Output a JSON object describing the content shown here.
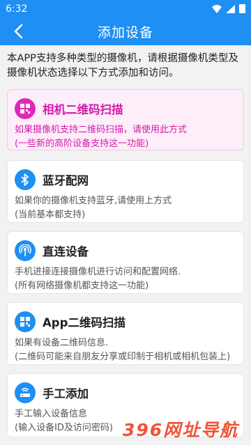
{
  "status_bar": {
    "time": "6:32"
  },
  "header": {
    "title": "添加设备"
  },
  "intro": {
    "text": "本APP支持多种类型的摄像机，请根据摄像机类型及摄像机状态选择以下方式添加和访问。"
  },
  "methods": [
    {
      "title": "相机二维码扫描",
      "line1": "如果摄像机支持二维码扫描，请使用此方式",
      "line2": "(一些新的高阶设备支持这一功能)",
      "icon": "qr-code-icon"
    },
    {
      "title": "蓝牙配网",
      "line1": "如果你的摄像机支持蓝牙,请使用上方式",
      "line2": "(当前基本都支持)",
      "icon": "bluetooth-icon"
    },
    {
      "title": "直连设备",
      "line1": "手机进接连接摄像机进行访问和配置网络.",
      "line2": "(所有网络摄像机都支持这一功能)",
      "icon": "signal-broadcast-icon"
    },
    {
      "title": "App二维码扫描",
      "line1": "如果有设备二维码信息.",
      "line2": "(二维码可能来自朋友分享或印制于相机或相机包装上)",
      "icon": "qr-code-icon"
    },
    {
      "title": "手工添加",
      "line1": "手工输入设备信息",
      "line2": "(输入设备ID及访问密码)",
      "icon": "router-icon"
    }
  ],
  "watermark": {
    "text": "396网址导航"
  },
  "colors": {
    "primary": "#1f8ff3",
    "highlight": "#e028b8",
    "highlight_bg": "#fdeef9"
  }
}
